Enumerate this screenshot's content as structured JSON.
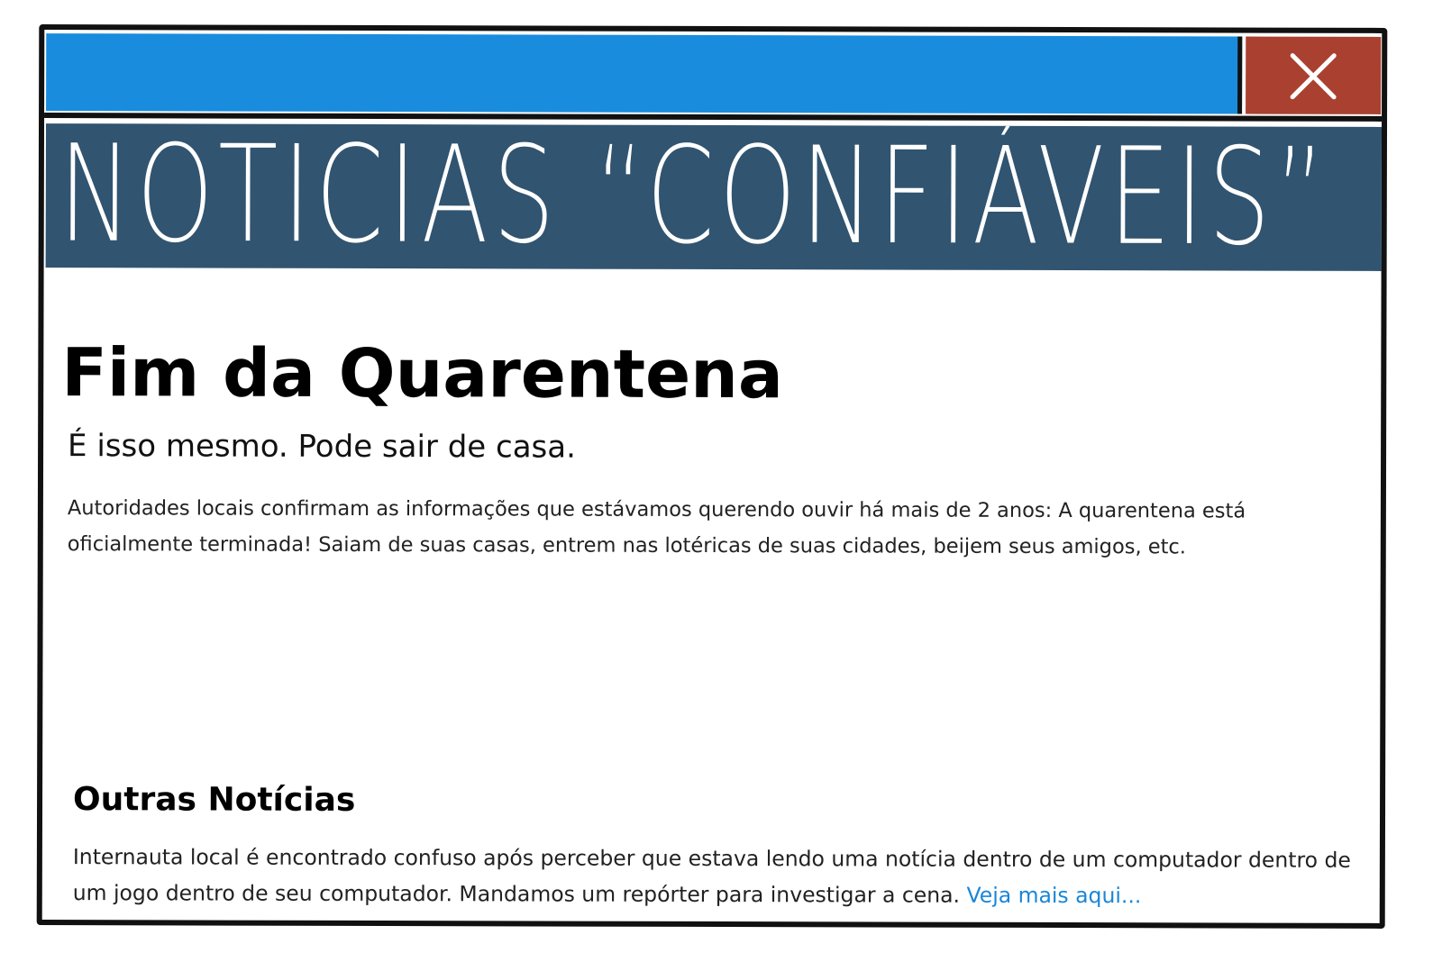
{
  "colors": {
    "titlebar": "#1a8cdd",
    "close_button": "#aa4130",
    "banner": "#315470",
    "link": "#1a86d8"
  },
  "window": {
    "close_icon": "close-icon"
  },
  "banner": {
    "title": "NOTICIAS “CONFIÁVEIS”"
  },
  "article": {
    "headline": "Fim da Quarentena",
    "subheadline": "É isso mesmo. Pode sair de casa.",
    "body": "Autoridades locais confirmam as informações que estávamos querendo ouvir há mais de 2 anos: A quarentena está oficialmente terminada! Saiam de suas casas, entrem nas lotéricas de suas cidades, beijem seus amigos, etc."
  },
  "other_news": {
    "title": "Outras Notícias",
    "body": "Internauta local é encontrado confuso após perceber que estava lendo uma notícia dentro de um computador dentro de um jogo dentro de seu computador. Mandamos um repórter para investigar a cena.",
    "link_label": "Veja mais aqui..."
  }
}
